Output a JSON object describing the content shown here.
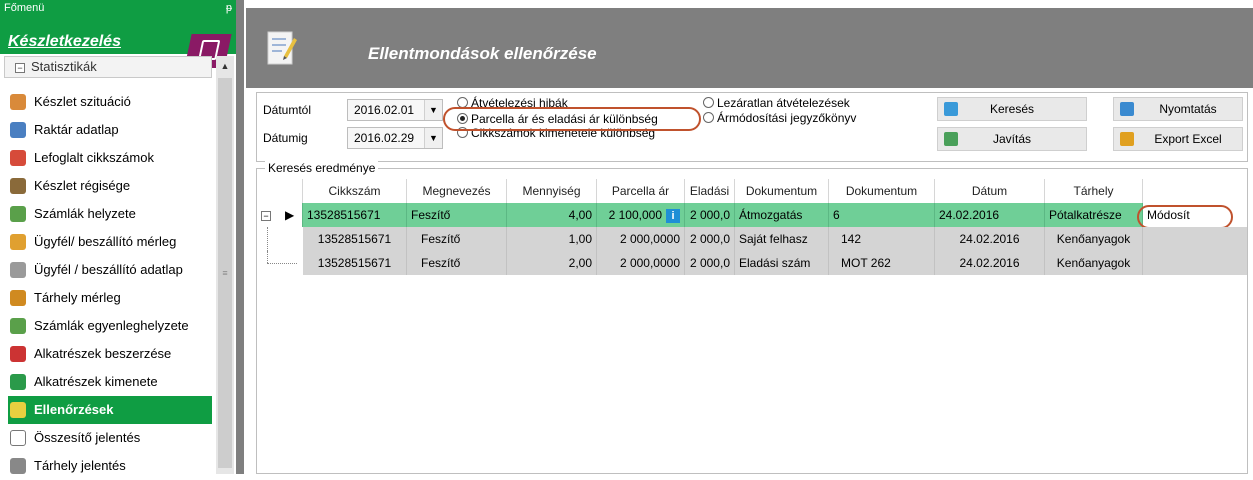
{
  "sidebar": {
    "menu_title": "Főmenü",
    "pin": "ᵽ",
    "module_title": "Készletkezelés",
    "group_label": "Statisztikák",
    "items": [
      {
        "label": "Készlet szituáció",
        "icon": "boxes-icon",
        "color": "#d98a3a",
        "active": false
      },
      {
        "label": "Raktár adatlap",
        "icon": "document-icon",
        "color": "#4a7fc1",
        "active": false
      },
      {
        "label": "Lefoglalt cikkszámok",
        "icon": "reserved-icon",
        "color": "#d64b3a",
        "active": false
      },
      {
        "label": "Készlet régisége",
        "icon": "age-icon",
        "color": "#8a6a3a",
        "active": false
      },
      {
        "label": "Számlák helyzete",
        "icon": "invoice-icon",
        "color": "#5aa04a",
        "active": false
      },
      {
        "label": "Ügyfél/ beszállító mérleg",
        "icon": "people-icon",
        "color": "#e0a030",
        "active": false
      },
      {
        "label": "Ügyfél / beszállító adatlap",
        "icon": "card-icon",
        "color": "#9a9a9a",
        "active": false
      },
      {
        "label": "Tárhely mérleg",
        "icon": "storage-icon",
        "color": "#d08a20",
        "active": false
      },
      {
        "label": "Számlák egyenleghelyzete",
        "icon": "balance-icon",
        "color": "#5aa04a",
        "active": false
      },
      {
        "label": "Alkatrészek beszerzése",
        "icon": "arrow-in-icon",
        "color": "#cc3333",
        "active": false
      },
      {
        "label": "Alkatrészek kimenete",
        "icon": "arrow-out-icon",
        "color": "#2a9a4a",
        "active": false
      },
      {
        "label": "Ellenőrzések",
        "icon": "check-icon",
        "color": "#e8d040",
        "active": true
      },
      {
        "label": "Összesítő jelentés",
        "icon": "summary-icon",
        "color": "#777777",
        "active": false
      },
      {
        "label": "Tárhely jelentés",
        "icon": "report-icon",
        "color": "#888888",
        "active": false
      }
    ]
  },
  "window": {
    "title": "Ellentmondások ellenőrzése"
  },
  "filter": {
    "date_from_label": "Dátumtól",
    "date_to_label": "Dátumig",
    "date_from": "2016.02.01",
    "date_to": "2016.02.29",
    "radios": [
      {
        "label": "Átvételezési hibák",
        "checked": false
      },
      {
        "label": "Parcella ár és eladási ár különbség",
        "checked": true
      },
      {
        "label": "Cikkszámok kimenetele különbség",
        "checked": false
      },
      {
        "label": "Lezáratlan átvételezések",
        "checked": false
      },
      {
        "label": "Ármódosítási jegyzőkönyv",
        "checked": false
      }
    ],
    "buttons": {
      "search": "Keresés",
      "fix": "Javítás",
      "print": "Nyomtatás",
      "export": "Export Excel"
    }
  },
  "results": {
    "label": "Keresés eredménye",
    "columns": [
      "Cikkszám",
      "Megnevezés",
      "Mennyiség",
      "Parcella ár",
      "Eladási",
      "Dokumentum",
      "Dokumentum",
      "Dátum",
      "Tárhely",
      ""
    ],
    "main_row": {
      "expand": "−",
      "pointer": "▶",
      "cikkszam": "13528515671",
      "megnevezes": "Feszítő",
      "mennyiseg": "4,00",
      "parcella_ar": "2 100,000",
      "info": "i",
      "eladasi": "2 000,0",
      "dokumentum1": "Átmozgatás",
      "dokumentum2": "6",
      "datum": "24.02.2016",
      "tarhely": "Pótalkatrésze",
      "action": "Módosít"
    },
    "sub_rows": [
      {
        "cikkszam": "13528515671",
        "megnevezes": "Feszítő",
        "mennyiseg": "1,00",
        "parcella_ar": "2 000,0000",
        "eladasi": "2 000,0",
        "dokumentum1": "Saját felhasz",
        "dokumentum2": "142",
        "datum": "24.02.2016",
        "tarhely": "Kenőanyagok"
      },
      {
        "cikkszam": "13528515671",
        "megnevezes": "Feszítő",
        "mennyiseg": "2,00",
        "parcella_ar": "2 000,0000",
        "eladasi": "2 000,0",
        "dokumentum1": "Eladási szám",
        "dokumentum2": "MOT 262",
        "datum": "24.02.2016",
        "tarhely": "Kenőanyagok"
      }
    ]
  },
  "colors": {
    "accent_green": "#0f9d43",
    "header_gray": "#7f7f7f",
    "main_row_green": "#6fcf97",
    "sub_row_gray": "#d4d4d4",
    "annotation": "#c0522d"
  }
}
